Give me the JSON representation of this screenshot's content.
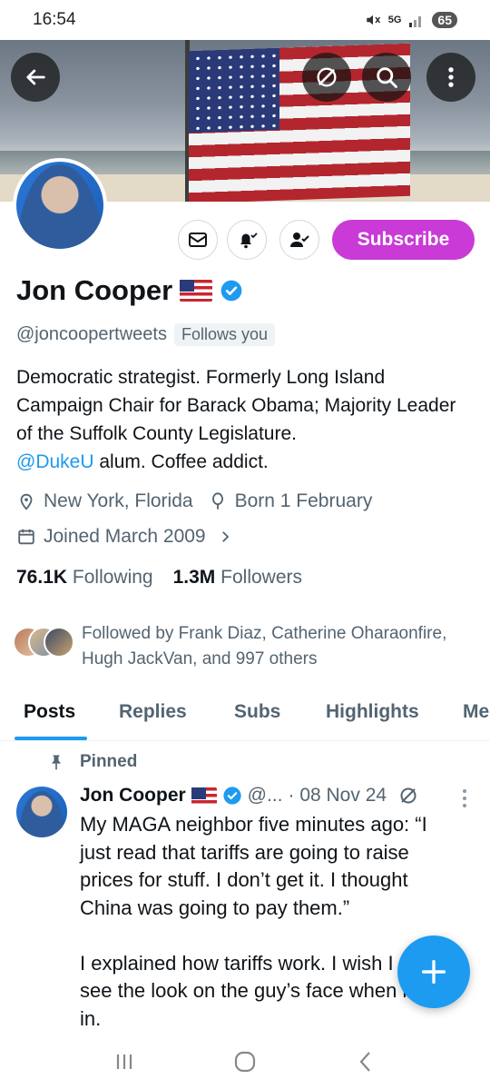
{
  "status_bar": {
    "time": "16:54",
    "network": "5G",
    "battery": "65"
  },
  "profile": {
    "name": "Jon Cooper",
    "handle": "@joncoopertweets",
    "follows_you": "Follows you",
    "bio_text": "Democratic strategist. Formerly Long Island Campaign Chair for Barack Obama; Majority Leader of the Suffolk County Legislature.",
    "bio_mention": "@DukeU",
    "bio_suffix": " alum. Coffee addict.",
    "location": "New York, Florida",
    "birthday": "Born 1 February",
    "joined": "Joined March 2009",
    "following_count": "76.1K",
    "following_label": "Following",
    "followers_count": "1.3M",
    "followers_label": "Followers",
    "followed_by": "Followed by Frank Diaz, Catherine Oharaonfire, Hugh JackVan, and 997 others"
  },
  "actions": {
    "subscribe_label": "Subscribe"
  },
  "tabs": [
    {
      "label": "Posts",
      "active": true
    },
    {
      "label": "Replies"
    },
    {
      "label": "Subs"
    },
    {
      "label": "Highlights"
    },
    {
      "label": "Me"
    }
  ],
  "pinned_post": {
    "pinned_label": "Pinned",
    "author_name": "Jon Cooper",
    "author_handle": "@...",
    "date": "· 08 Nov 24",
    "text": "My MAGA neighbor five minutes ago: “I just read that tariffs are going to raise prices for stuff. I don’t get it. I thought China was going to pay them.”\n\nI explained how tariffs work. I wish I could see the look on the guy’s face when it sunk in."
  },
  "colors": {
    "accent": "#1d9bf0",
    "subscribe": "#c93ad6",
    "muted": "#536471"
  }
}
